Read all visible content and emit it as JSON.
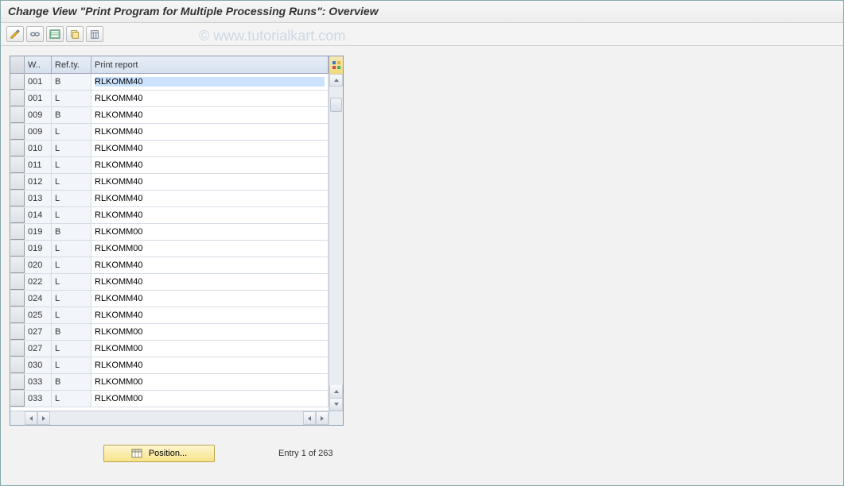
{
  "title": "Change View \"Print Program for Multiple Processing Runs\": Overview",
  "watermark": "© www.tutorialkart.com",
  "toolbar": {
    "btn1": "toggle-edit",
    "btn2": "glasses-detail",
    "btn3": "new-entries",
    "btn4": "copy-as",
    "btn5": "delete"
  },
  "columns": {
    "w": "W..",
    "ref": "Ref.ty.",
    "pr": "Print report"
  },
  "rows": [
    {
      "w": "001",
      "ref": "B",
      "pr": "RLKOMM40"
    },
    {
      "w": "001",
      "ref": "L",
      "pr": "RLKOMM40"
    },
    {
      "w": "009",
      "ref": "B",
      "pr": "RLKOMM40"
    },
    {
      "w": "009",
      "ref": "L",
      "pr": "RLKOMM40"
    },
    {
      "w": "010",
      "ref": "L",
      "pr": "RLKOMM40"
    },
    {
      "w": "011",
      "ref": "L",
      "pr": "RLKOMM40"
    },
    {
      "w": "012",
      "ref": "L",
      "pr": "RLKOMM40"
    },
    {
      "w": "013",
      "ref": "L",
      "pr": "RLKOMM40"
    },
    {
      "w": "014",
      "ref": "L",
      "pr": "RLKOMM40"
    },
    {
      "w": "019",
      "ref": "B",
      "pr": "RLKOMM00"
    },
    {
      "w": "019",
      "ref": "L",
      "pr": "RLKOMM00"
    },
    {
      "w": "020",
      "ref": "L",
      "pr": "RLKOMM40"
    },
    {
      "w": "022",
      "ref": "L",
      "pr": "RLKOMM40"
    },
    {
      "w": "024",
      "ref": "L",
      "pr": "RLKOMM40"
    },
    {
      "w": "025",
      "ref": "L",
      "pr": "RLKOMM40"
    },
    {
      "w": "027",
      "ref": "B",
      "pr": "RLKOMM00"
    },
    {
      "w": "027",
      "ref": "L",
      "pr": "RLKOMM00"
    },
    {
      "w": "030",
      "ref": "L",
      "pr": "RLKOMM40"
    },
    {
      "w": "033",
      "ref": "B",
      "pr": "RLKOMM00"
    },
    {
      "w": "033",
      "ref": "L",
      "pr": "RLKOMM00"
    }
  ],
  "footer": {
    "position_label": "Position...",
    "entry_text": "Entry 1 of 263"
  }
}
